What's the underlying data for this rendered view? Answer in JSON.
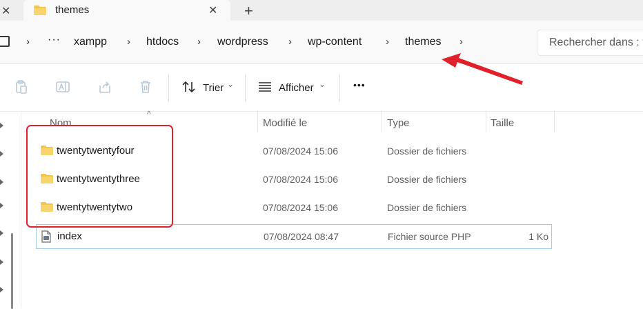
{
  "tab": {
    "title": "themes",
    "close_glyph": "✕",
    "left_close_glyph": "✕",
    "new_tab_glyph": "+"
  },
  "breadcrumb": {
    "separator": "›",
    "more": "···",
    "items": [
      "xampp",
      "htdocs",
      "wordpress",
      "wp-content",
      "themes"
    ]
  },
  "search": {
    "placeholder": "Rechercher dans : t"
  },
  "toolbar": {
    "sort_label": "Trier",
    "view_label": "Afficher",
    "more_glyph": "•••",
    "dropdown_glyph": "⌄"
  },
  "columns": {
    "name": "Nom",
    "modified": "Modifié le",
    "type": "Type",
    "size": "Taille"
  },
  "files": [
    {
      "name": "twentytwentyfour",
      "modified": "07/08/2024 15:06",
      "type": "Dossier de fichiers",
      "size": "",
      "icon": "folder-icon"
    },
    {
      "name": "twentytwentythree",
      "modified": "07/08/2024 15:06",
      "type": "Dossier de fichiers",
      "size": "",
      "icon": "folder-icon"
    },
    {
      "name": "twentytwentytwo",
      "modified": "07/08/2024 15:06",
      "type": "Dossier de fichiers",
      "size": "",
      "icon": "folder-icon"
    },
    {
      "name": "index",
      "modified": "07/08/2024 08:47",
      "type": "Fichier source PHP",
      "size": "1 Ko",
      "icon": "php-file-icon"
    }
  ],
  "colors": {
    "annotation": "#e0212b",
    "folder": "#f4c44e",
    "selection": "#a6cde6"
  }
}
